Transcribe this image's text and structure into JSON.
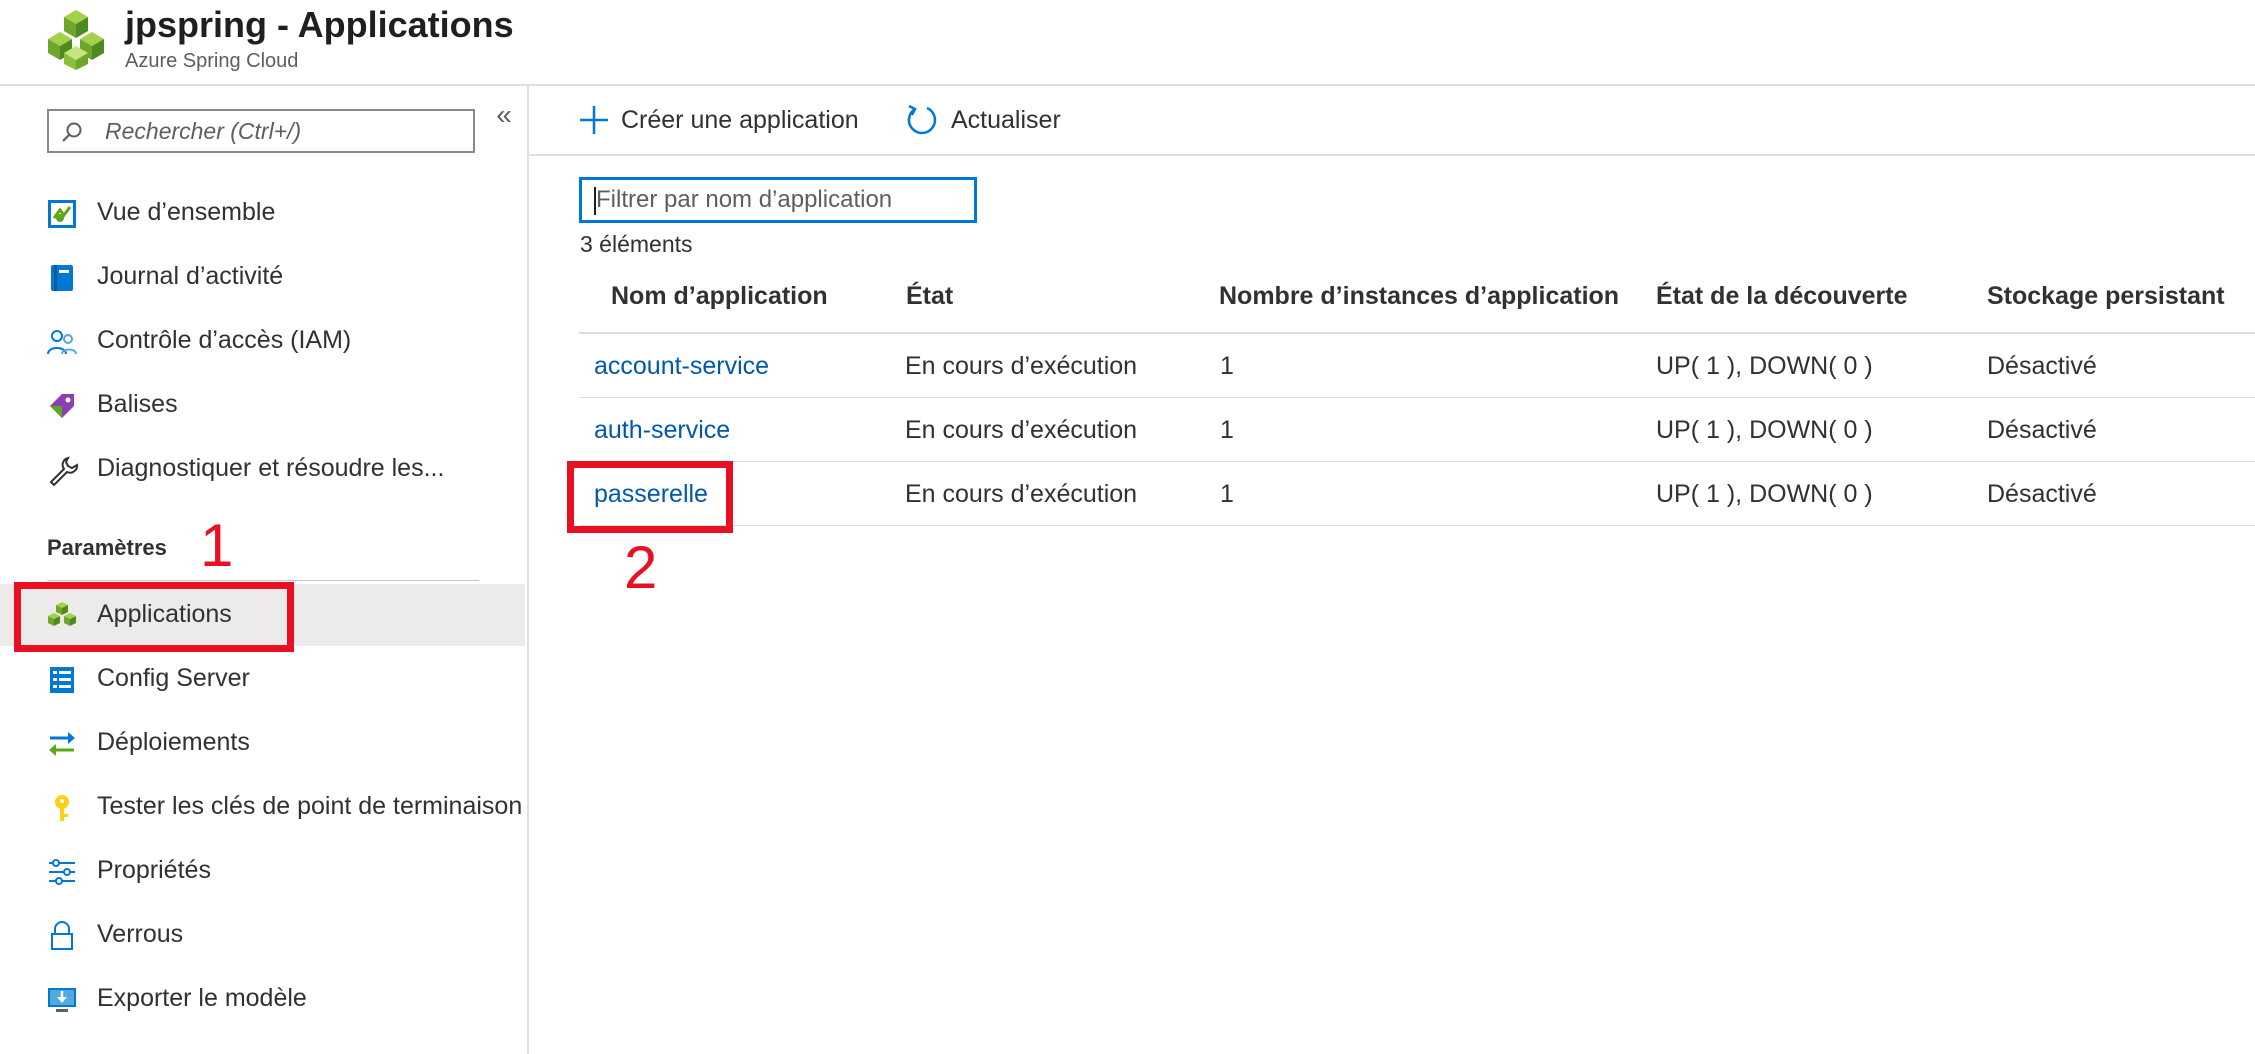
{
  "header": {
    "title": "jpspring - Applications",
    "subtitle": "Azure Spring Cloud",
    "logo": "azure-spring-cloud-logo"
  },
  "sidebar": {
    "search": {
      "placeholder": "Rechercher (Ctrl+/)",
      "value": ""
    },
    "collapse_glyph": "«",
    "items_top": [
      {
        "label": "Vue d’ensemble",
        "icon": "overview-icon"
      },
      {
        "label": "Journal d’activité",
        "icon": "activity-log-icon"
      },
      {
        "label": "Contrôle d’accès (IAM)",
        "icon": "iam-icon"
      },
      {
        "label": "Balises",
        "icon": "tag-icon"
      },
      {
        "label": "Diagnostiquer et résoudre les...",
        "icon": "wrench-icon"
      }
    ],
    "section_label": "Paramètres",
    "items_settings": [
      {
        "label": "Applications",
        "icon": "applications-icon",
        "selected": true
      },
      {
        "label": "Config Server",
        "icon": "config-server-icon"
      },
      {
        "label": "Déploiements",
        "icon": "deployments-icon"
      },
      {
        "label": "Tester les clés de point de terminaison",
        "icon": "key-icon"
      },
      {
        "label": "Propriétés",
        "icon": "properties-icon"
      },
      {
        "label": "Verrous",
        "icon": "lock-icon"
      },
      {
        "label": "Exporter le modèle",
        "icon": "export-template-icon"
      }
    ]
  },
  "toolbar": {
    "create_label": "Créer une application",
    "refresh_label": "Actualiser"
  },
  "content": {
    "filter": {
      "placeholder": "Filtrer par nom d’application",
      "value": ""
    },
    "item_count": "3 éléments",
    "columns": [
      "Nom d’application",
      "État",
      "Nombre d’instances d’application",
      "État de la découverte",
      "Stockage persistant"
    ],
    "rows": [
      {
        "name": "account-service",
        "state": "En cours d’exécution",
        "instances": "1",
        "discovery": "UP( 1 ), DOWN( 0 )",
        "storage": "Désactivé"
      },
      {
        "name": "auth-service",
        "state": "En cours d’exécution",
        "instances": "1",
        "discovery": "UP( 1 ), DOWN( 0 )",
        "storage": "Désactivé"
      },
      {
        "name": "passerelle",
        "state": "En cours d’exécution",
        "instances": "1",
        "discovery": "UP( 1 ), DOWN( 0 )",
        "storage": "Désactivé"
      }
    ]
  },
  "annotations": {
    "step1": "1",
    "step2": "2",
    "color": "#e81123"
  },
  "colors": {
    "accent": "#0078d4",
    "link": "#0058ad",
    "selected_bg": "#edebe9"
  }
}
